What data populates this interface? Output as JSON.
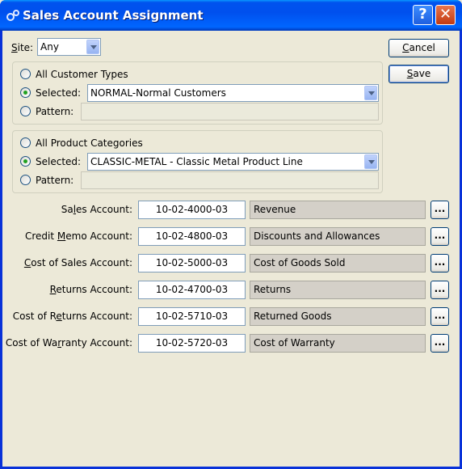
{
  "window": {
    "title": "Sales Account Assignment"
  },
  "site": {
    "label": "Site:",
    "label_u": "S",
    "label_rest": "ite:",
    "value": "Any"
  },
  "buttons": {
    "cancel": "Cancel",
    "cancel_u": "C",
    "cancel_rest": "ancel",
    "save": "Save",
    "save_u": "S",
    "save_rest": "ave"
  },
  "customer_types": {
    "all_label": "All Customer Types",
    "selected_label": "Selected:",
    "selected_value": "NORMAL-Normal Customers",
    "pattern_label": "Pattern:"
  },
  "product_categories": {
    "all_label": "All Product Categories",
    "selected_label": "Selected:",
    "selected_value": "CLASSIC-METAL - Classic Metal Product Line",
    "pattern_label": "Pattern:"
  },
  "accounts": [
    {
      "label_pre": "Sa",
      "label_u": "l",
      "label_post": "es Account:",
      "number": "10-02-4000-03",
      "description": "Revenue"
    },
    {
      "label_pre": "Credit ",
      "label_u": "M",
      "label_post": "emo Account:",
      "number": "10-02-4800-03",
      "description": "Discounts and Allowances"
    },
    {
      "label_pre": "",
      "label_u": "C",
      "label_post": "ost of Sales Account:",
      "number": "10-02-5000-03",
      "description": "Cost of Goods Sold"
    },
    {
      "label_pre": "",
      "label_u": "R",
      "label_post": "eturns Account:",
      "number": "10-02-4700-03",
      "description": "Returns"
    },
    {
      "label_pre": "Cost of R",
      "label_u": "e",
      "label_post": "turns Account:",
      "number": "10-02-5710-03",
      "description": "Returned Goods"
    },
    {
      "label_pre": "Cost of Wa",
      "label_u": "r",
      "label_post": "ranty Account:",
      "number": "10-02-5720-03",
      "description": "Cost of Warranty"
    }
  ],
  "lookup_button": "...",
  "icons": {
    "title": "gears-icon",
    "help": "help-icon",
    "close": "close-icon"
  },
  "colors": {
    "titlebar": "#0050ee",
    "selected_radio": "#21a121",
    "window_bg": "#ece9d8"
  }
}
